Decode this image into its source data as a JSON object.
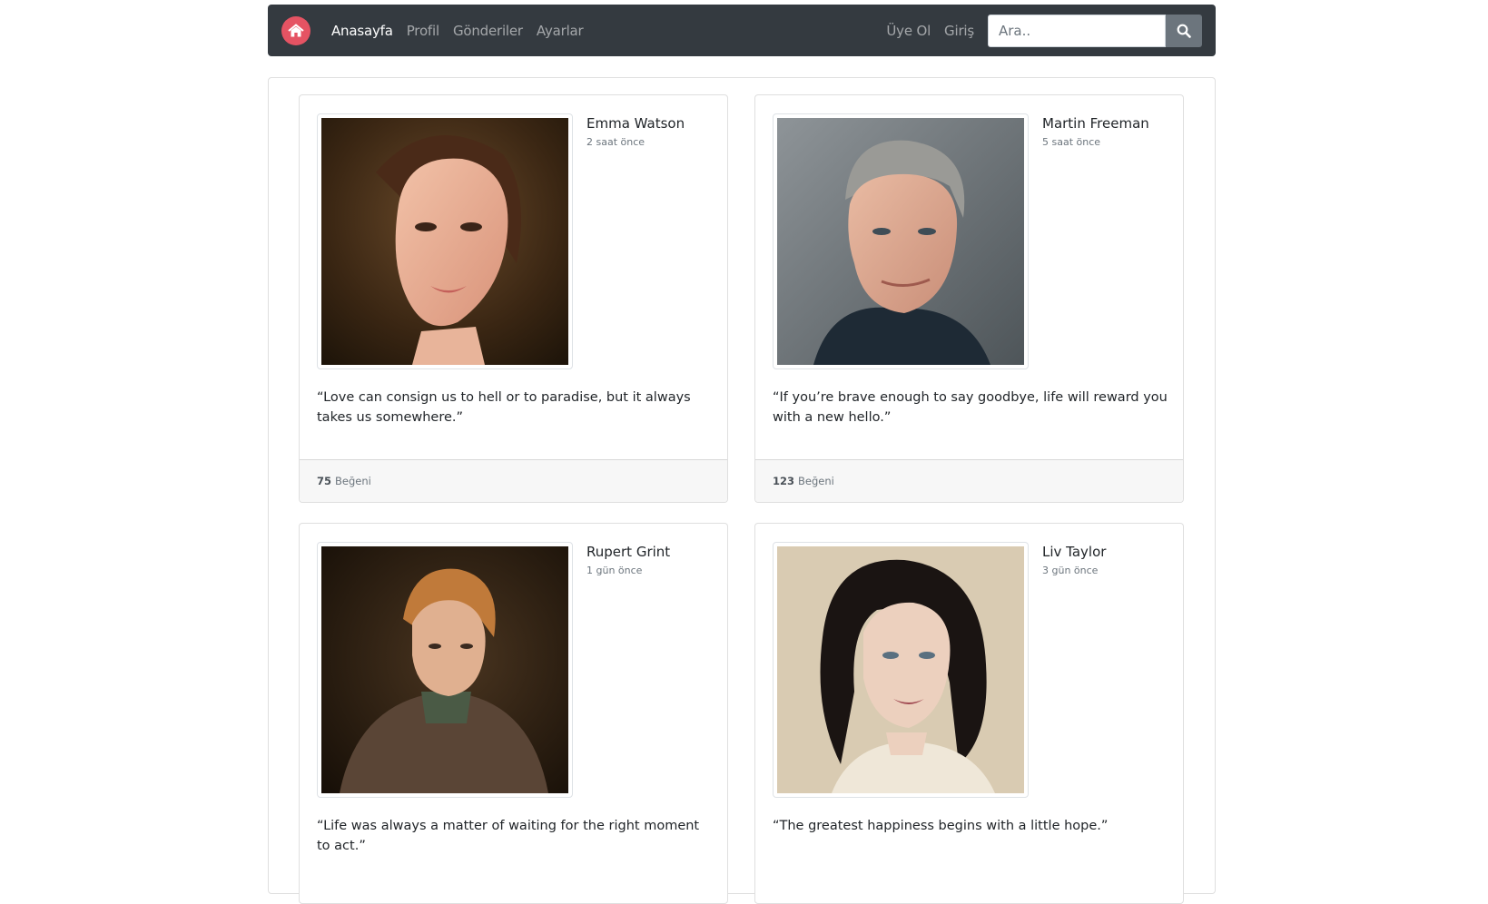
{
  "nav": {
    "logo": "home-icon",
    "links": [
      "Anasayfa",
      "Profil",
      "Gönderiler",
      "Ayarlar"
    ],
    "register": "Üye Ol",
    "login": "Giriş",
    "search_placeholder": "Ara..",
    "search_icon": "search-icon"
  },
  "posts": [
    {
      "author": "Emma Watson",
      "time": "2 saat önce",
      "quote": "“Love can consign us to hell or to paradise, but it always takes us somewhere.”",
      "likes": "75",
      "likes_label": "Beğeni"
    },
    {
      "author": "Martin Freeman",
      "time": "5 saat önce",
      "quote": "“If you’re brave enough to say goodbye, life will reward you with a new hello.”",
      "likes": "123",
      "likes_label": "Beğeni"
    },
    {
      "author": "Rupert Grint",
      "time": "1 gün önce",
      "quote": "“Life was always a matter of waiting for the right moment to act.”",
      "likes": "",
      "likes_label": ""
    },
    {
      "author": "Liv Taylor",
      "time": "3 gün önce",
      "quote": "“The greatest happiness begins with a little hope.”",
      "likes": "",
      "likes_label": ""
    }
  ],
  "colors": {
    "navbar": "#343a40",
    "brand": "#e55363",
    "search_button": "#6c757d"
  }
}
